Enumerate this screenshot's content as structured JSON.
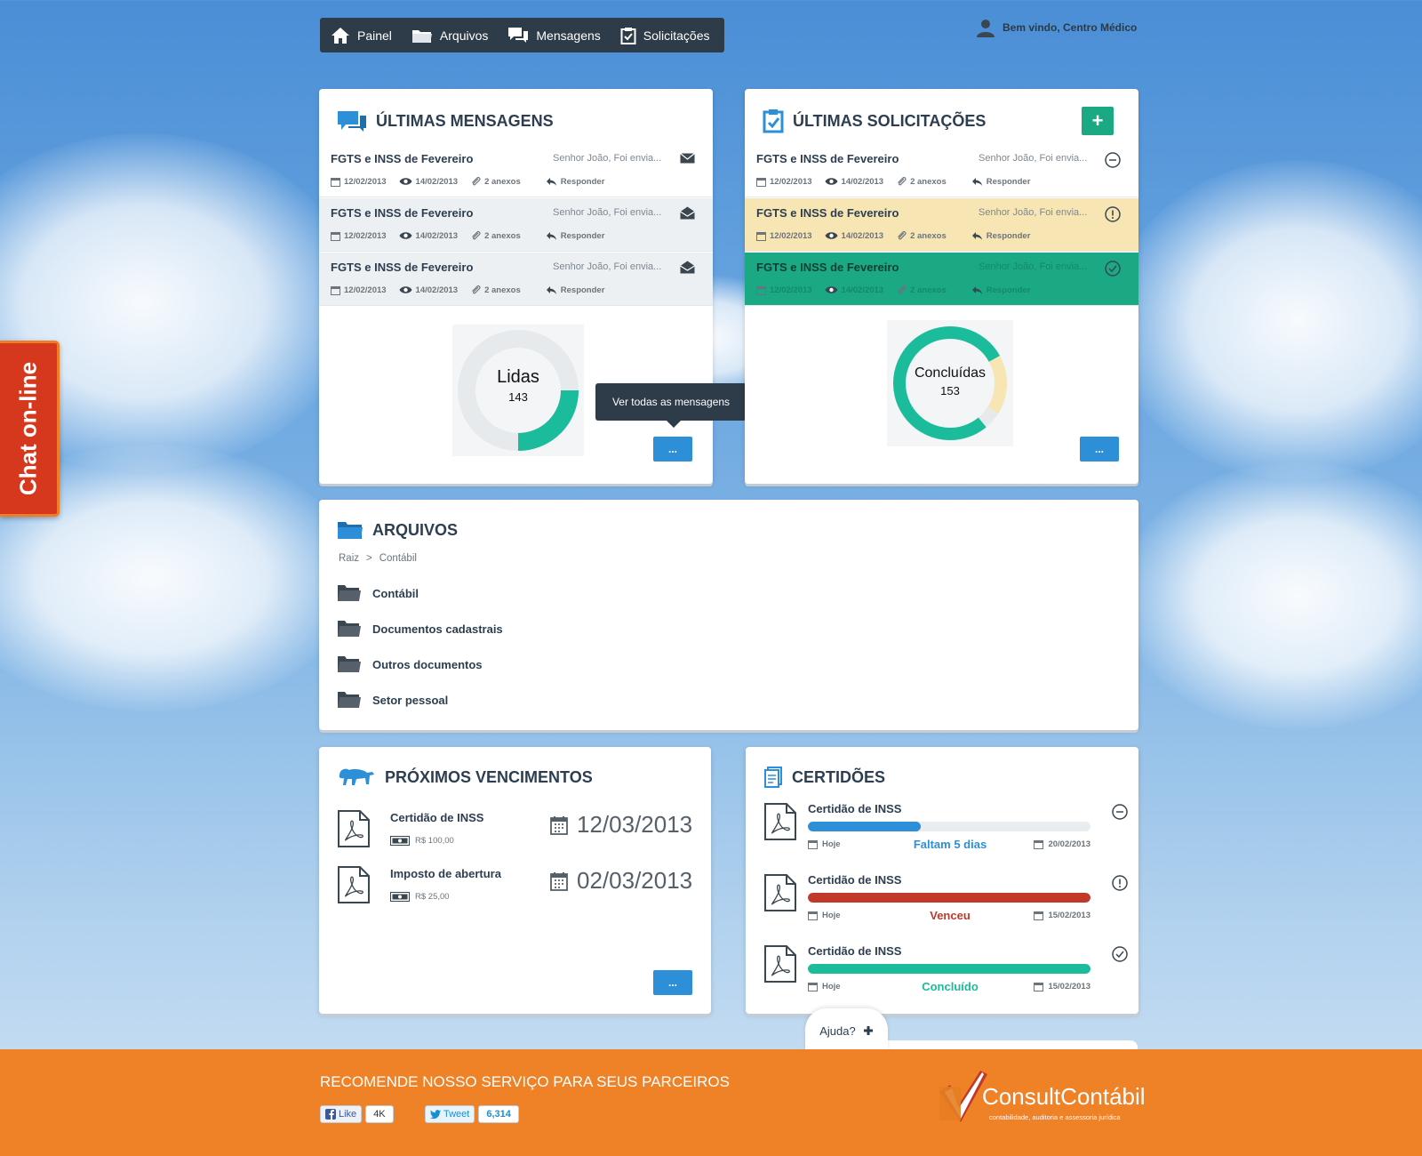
{
  "nav": {
    "items": [
      {
        "label": "Painel",
        "icon": "home-icon"
      },
      {
        "label": "Arquivos",
        "icon": "folder-icon"
      },
      {
        "label": "Mensagens",
        "icon": "chat-icon"
      },
      {
        "label": "Solicitações",
        "icon": "clipboard-icon"
      }
    ],
    "welcome": "Bem vindo, Centro Médico"
  },
  "chat_tab": "Chat on-line",
  "mensagens": {
    "title": "ÚLTIMAS MENSAGENS",
    "rows": [
      {
        "title": "FGTS  e INSS de Fevereiro",
        "preview": "Senhor João, Foi envia...",
        "date_sent": "12/02/2013",
        "date_read": "14/02/2013",
        "attachments": "2 anexos",
        "reply": "Responder"
      },
      {
        "title": "FGTS  e INSS de Fevereiro",
        "preview": "Senhor João, Foi envia...",
        "date_sent": "12/02/2013",
        "date_read": "14/02/2013",
        "attachments": "2 anexos",
        "reply": "Responder"
      },
      {
        "title": "FGTS  e INSS de Fevereiro",
        "preview": "Senhor João, Foi envia...",
        "date_sent": "12/02/2013",
        "date_read": "14/02/2013",
        "attachments": "2 anexos",
        "reply": "Responder"
      }
    ],
    "donut": {
      "label": "Lidas",
      "value": "143",
      "fraction": 0.25,
      "color": "#1bbc9b"
    },
    "tooltip": "Ver todas as mensagens",
    "more": "..."
  },
  "solicitacoes": {
    "title": "ÚLTIMAS SOLICITAÇÕES",
    "add": "+",
    "rows": [
      {
        "title": "FGTS  e INSS de Fevereiro",
        "preview": "Senhor João, Foi envia...",
        "date_sent": "12/02/2013",
        "date_read": "14/02/2013",
        "attachments": "2 anexos",
        "reply": "Responder",
        "status": "pending"
      },
      {
        "title": "FGTS  e INSS de Fevereiro",
        "preview": "Senhor João, Foi envia...",
        "date_sent": "12/02/2013",
        "date_read": "14/02/2013",
        "attachments": "2 anexos",
        "reply": "Responder",
        "status": "warning"
      },
      {
        "title": "FGTS  e INSS de Fevereiro",
        "preview": "Senhor João, Foi envia...",
        "date_sent": "12/02/2013",
        "date_read": "14/02/2013",
        "attachments": "2 anexos",
        "reply": "Responder",
        "status": "done"
      }
    ],
    "donut": {
      "label": "Concluídas",
      "value": "153",
      "color": "#1bbc9b",
      "segments": [
        0.78,
        0.17,
        0.05
      ]
    },
    "more": "..."
  },
  "arquivos": {
    "title": "ARQUIVOS",
    "breadcrumb": [
      "Raiz",
      ">",
      "Contábil"
    ],
    "folders": [
      "Contábil",
      "Documentos cadastrais",
      "Outros documentos",
      "Setor pessoal"
    ]
  },
  "vencimentos": {
    "title": "PRÓXIMOS VENCIMENTOS",
    "items": [
      {
        "title": "Certidão de INSS",
        "price": "R$ 100,00",
        "date": "12/03/2013"
      },
      {
        "title": "Imposto de abertura",
        "price": "R$ 25,00",
        "date": "02/03/2013"
      }
    ],
    "more": "..."
  },
  "certidoes": {
    "title": "CERTIDÕES",
    "items": [
      {
        "title": "Certidão de INSS",
        "start": "Hoje",
        "status_text": "Faltam 5 dias",
        "end": "20/02/2013",
        "progress": 0.4,
        "color": "#2d8fd8",
        "text_color": "#2d8fd8",
        "state": "pending"
      },
      {
        "title": "Certidão de INSS",
        "start": "Hoje",
        "status_text": "Venceu",
        "end": "15/02/2013",
        "progress": 1.0,
        "color": "#c0392b",
        "text_color": "#c0392b",
        "state": "warning"
      },
      {
        "title": "Certidão de INSS",
        "start": "Hoje",
        "status_text": "Concluído",
        "end": "15/02/2013",
        "progress": 1.0,
        "color": "#1bbc9b",
        "text_color": "#1bbc9b",
        "state": "done"
      }
    ]
  },
  "ajuda": "Ajuda?",
  "footer": {
    "recommend": "RECOMENDE NOSSO SERVIÇO PARA SEUS PARCEIROS",
    "like": "Like",
    "like_count": "4K",
    "tweet": "Tweet",
    "tweet_count": "6,314",
    "logo_name": "ConsultContábil",
    "logo_tagline": "contabilidade, auditoria e assessoria jurídica"
  },
  "colors": {
    "accent": "#2d8fd8",
    "nav": "#2e3b48",
    "green": "#1aa982",
    "footer": "#ef8127"
  }
}
